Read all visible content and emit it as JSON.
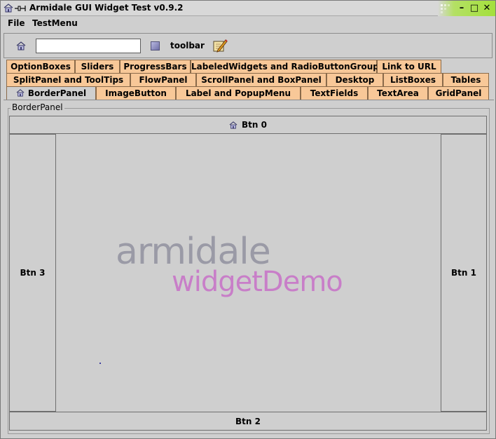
{
  "window": {
    "title": "Armidale GUI Widget Test v0.9.2",
    "icons": [
      "home-icon",
      "pin-icon"
    ],
    "controls": {
      "minimize": "–",
      "maximize": "□",
      "close": "✕"
    }
  },
  "menubar": {
    "items": [
      "File",
      "TestMenu"
    ]
  },
  "toolbar": {
    "input_value": "",
    "label": "toolbar",
    "icons": [
      "home-icon",
      "square-icon",
      "pencil-icon"
    ]
  },
  "tabs": {
    "row1": [
      "OptionBoxes",
      "Sliders",
      "ProgressBars",
      "LabeledWidgets and RadioButtonGroup",
      "Link to URL"
    ],
    "row2": [
      "SplitPanel and ToolTips",
      "FlowPanel",
      "ScrollPanel and BoxPanel",
      "Desktop",
      "ListBoxes",
      "Tables"
    ],
    "row3": [
      "BorderPanel",
      "ImageButton",
      "Label and PopupMenu",
      "TextFields",
      "TextArea",
      "GridPanel"
    ],
    "selected": "BorderPanel"
  },
  "panel": {
    "group_title": "BorderPanel",
    "buttons": {
      "north": "Btn 0",
      "east": "Btn 1",
      "south": "Btn 2",
      "west": "Btn 3"
    },
    "logo": {
      "line1": "armidale",
      "line2": "widgetDemo"
    }
  },
  "colors": {
    "tab": "#f8c898",
    "tab_selected": "#cfcfcf",
    "logo_gray": "#9a9aa6",
    "logo_pink": "#c87ec8",
    "wm_green": "#a4e03c"
  }
}
